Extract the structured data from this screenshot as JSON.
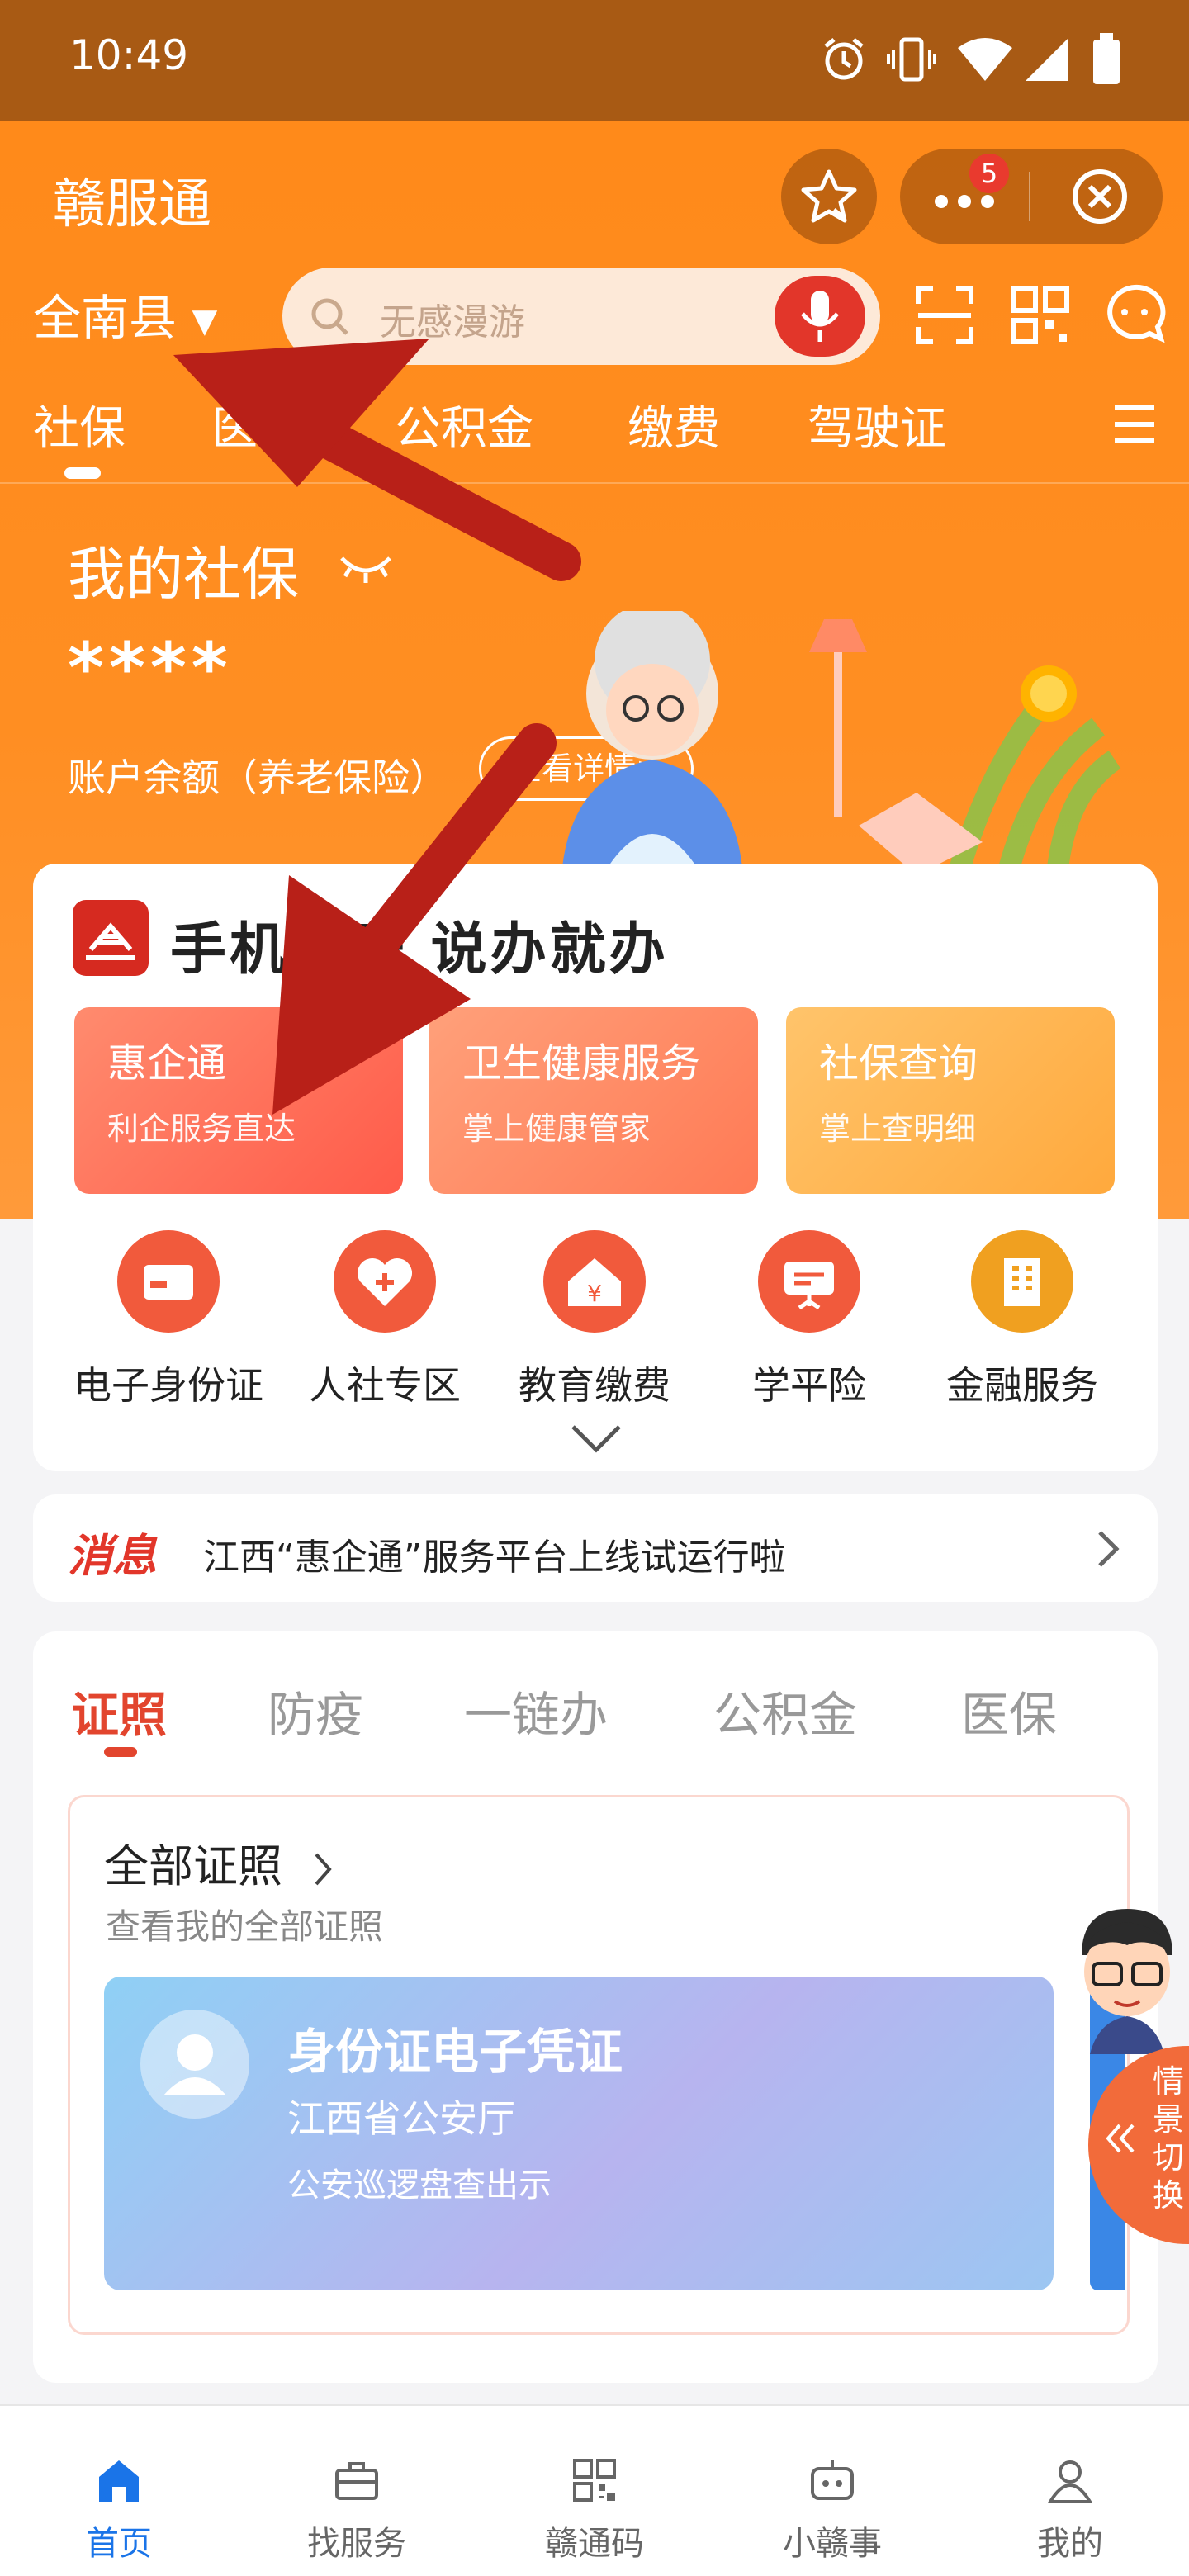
{
  "status_bar": {
    "time": "10:49"
  },
  "header": {
    "app_title": "赣服通",
    "badge_count": "5",
    "location": "全南县",
    "search_placeholder": "无感漫游"
  },
  "category_tabs": [
    "社保",
    "医保",
    "公积金",
    "缴费",
    "驾驶证"
  ],
  "hero": {
    "title": "我的社保",
    "masked_value": "****",
    "balance_label": "账户余额（养老保险）",
    "detail_button": "查看详情>"
  },
  "main_card": {
    "slogan": "手机一开 说办就办",
    "services": [
      {
        "title": "惠企通",
        "subtitle": "利企服务直达"
      },
      {
        "title": "卫生健康服务",
        "subtitle": "掌上健康管家"
      },
      {
        "title": "社保查询",
        "subtitle": "掌上查明细"
      }
    ],
    "quick_icons": [
      {
        "label": "电子身份证",
        "icon": "id-card-icon"
      },
      {
        "label": "人社专区",
        "icon": "heart-plus-icon"
      },
      {
        "label": "教育缴费",
        "icon": "yuan-house-icon"
      },
      {
        "label": "学平险",
        "icon": "presentation-icon"
      },
      {
        "label": "金融服务",
        "icon": "building-icon"
      }
    ]
  },
  "notice": {
    "tag": "消息",
    "text": "江西“惠企通”服务平台上线试运行啦"
  },
  "cert_section": {
    "tabs": [
      "证照",
      "防疫",
      "一链办",
      "公积金",
      "医保"
    ],
    "active_tab": "证照",
    "all_title": "全部证照",
    "all_subtitle": "查看我的全部证照",
    "id_card": {
      "title": "身份证电子凭证",
      "issuer": "江西省公安厅",
      "note": "公安巡逻盘查出示"
    }
  },
  "floating_badge": {
    "text_lines": [
      "情",
      "景",
      "切",
      "换"
    ]
  },
  "bottom_nav": [
    {
      "label": "首页",
      "icon": "home-icon",
      "active": true
    },
    {
      "label": "找服务",
      "icon": "briefcase-icon",
      "active": false
    },
    {
      "label": "赣通码",
      "icon": "qr-code-icon",
      "active": false
    },
    {
      "label": "小赣事",
      "icon": "robot-icon",
      "active": false
    },
    {
      "label": "我的",
      "icon": "user-icon",
      "active": false
    }
  ],
  "colors": {
    "status_bar": "#a85a14",
    "header_orange": "#ff8a1a",
    "accent_red": "#e2362a",
    "active_blue": "#1a74e8"
  }
}
